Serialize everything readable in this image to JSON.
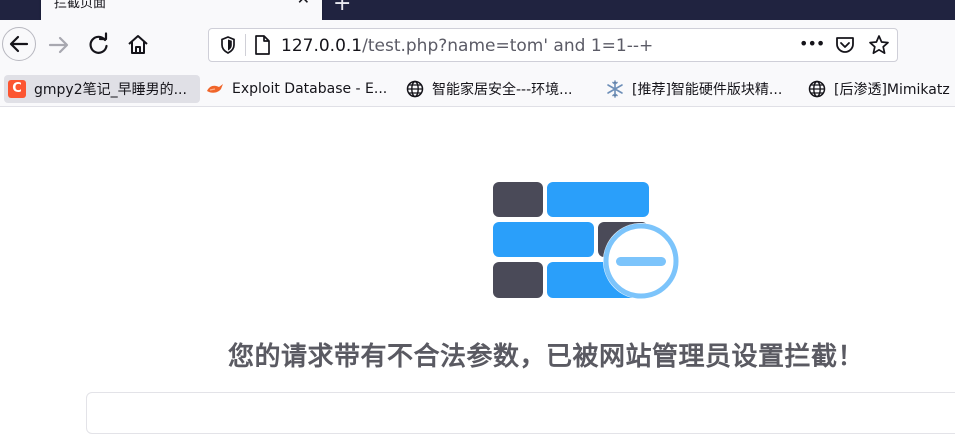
{
  "tab": {
    "title": "拦截页面",
    "close": "✕",
    "new_tab": "+"
  },
  "nav": {
    "back": "back-arrow-icon",
    "forward": "forward-arrow-icon",
    "reload": "reload-icon",
    "home": "home-icon"
  },
  "url": {
    "host": "127.0.0.1",
    "rest": "/test.php?name=tom' and 1=1--+",
    "menu": "•••"
  },
  "bookmarks": [
    {
      "label": "gmpy2笔记_早睡男的...",
      "icon": "csdn-icon"
    },
    {
      "label": "Exploit Database - E...",
      "icon": "exploit-db-icon"
    },
    {
      "label": "智能家居安全---环境...",
      "icon": "globe-icon"
    },
    {
      "label": "[推荐]智能硬件版块精...",
      "icon": "snowflake-icon"
    },
    {
      "label": "[后渗透]Mimikatz",
      "icon": "globe-icon"
    }
  ],
  "page": {
    "headline": "您的请求带有不合法参数，已被网站管理员设置拦截！"
  },
  "colors": {
    "brick_dark": "#4a4a58",
    "brick_blue": "#2a9ffa",
    "ring": "#7cc4fb"
  }
}
